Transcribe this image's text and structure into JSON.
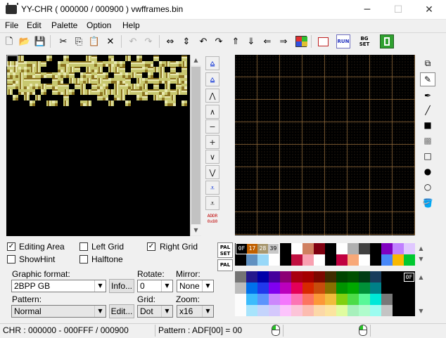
{
  "window": {
    "title": "YY-CHR ( 000000 / 000900 ) vwfframes.bin",
    "minimize_glyph": "─",
    "maximize_glyph": "☐",
    "close_glyph": "✕"
  },
  "menu": [
    "File",
    "Edit",
    "Palette",
    "Option",
    "Help"
  ],
  "toolbar_icons": [
    "new-file-icon",
    "open-folder-icon",
    "save-icon",
    "cut-icon",
    "copy-icon",
    "paste-icon",
    "delete-icon",
    "undo-icon",
    "redo-icon",
    "flip-horizontal-icon",
    "flip-vertical-icon",
    "rotate-left-icon",
    "rotate-right-icon",
    "shift-up-icon",
    "shift-down-icon",
    "shift-left-icon",
    "shift-right-icon",
    "replace-color-icon",
    "pattern-icon",
    "run-icon",
    "bg-set-icon",
    "bookmark-icon"
  ],
  "toolbar_glyphs": {
    "new": "🗋",
    "open": "📂",
    "save": "💾",
    "cut": "✂",
    "copy": "⎘",
    "paste": "📋",
    "delete": "✕",
    "undo": "↶",
    "redo": "↷",
    "flip_h": "⇔",
    "flip_v": "⇕",
    "rot_l": "↶",
    "rot_r": "↷",
    "up": "⇑",
    "down": "⇓",
    "left": "⇐",
    "right": "⇒",
    "run": "RUN",
    "bgset": "BG SET"
  },
  "nav_buttons": [
    "⩠",
    "⩠",
    "⋀",
    "∧",
    "−",
    "+",
    "∨",
    "⋁",
    "⩡",
    "⩡"
  ],
  "addr_button": {
    "line1": "ADDR",
    "line2": "0x80"
  },
  "tools_glyphs": [
    "⧉",
    "✎",
    "✒",
    "╱",
    "■",
    "▩",
    "□",
    "●",
    "○",
    "🪣"
  ],
  "checkboxes": {
    "editing_area": {
      "label": "Editing Area",
      "checked": true
    },
    "left_grid": {
      "label": "Left Grid",
      "checked": false
    },
    "right_grid": {
      "label": "Right Grid",
      "checked": true
    },
    "show_hint": {
      "label": "ShowHint",
      "checked": false
    },
    "halftone": {
      "label": "Halftone",
      "checked": false
    }
  },
  "form": {
    "graphic_format_label": "Graphic format:",
    "graphic_format": "2BPP GB",
    "info_button": "Info...",
    "rotate_label": "Rotate:",
    "rotate": "0",
    "mirror_label": "Mirror:",
    "mirror": "None",
    "pattern_label": "Pattern:",
    "pattern": "Normal",
    "edit_button": "Edit...",
    "grid_label": "Grid:",
    "grid": "Dot",
    "zoom_label": "Zoom:",
    "zoom": "x16",
    "dropdown_glyph": "▼"
  },
  "palette": {
    "pal_set_label_1": "PAL",
    "pal_set_label_2": "SET",
    "pal_label": "PAL",
    "selected_labels": [
      "0F",
      "17",
      "28",
      "39"
    ],
    "row_colors": [
      "#000000",
      "#ff7f00",
      "#d8c8a0",
      "#ffffff",
      "#000000",
      "#ffffff",
      "#d08060",
      "#800010",
      "#000000",
      "#ffffff",
      "#b0b0b0",
      "#404040",
      "#000000",
      "#8000c0",
      "#c080ff",
      "#e0c8ff",
      "#000000",
      "#6090c0",
      "#98d8f8",
      "#ffffff",
      "#000000",
      "#c01040",
      "#f8a0b0",
      "#ffffff",
      "#000000",
      "#c00040",
      "#f8a878",
      "#ffffff",
      "#000000",
      "#4888f8",
      "#f8b800",
      "#00c830"
    ],
    "master_colors": [
      "#747474",
      "#24188c",
      "#0000a8",
      "#44009c",
      "#8c0074",
      "#a80010",
      "#a40000",
      "#7c0800",
      "#402c00",
      "#004400",
      "#005000",
      "#003c14",
      "#183c5c",
      "#000000",
      "#000000",
      "#000000",
      "#bcbcbc",
      "#0070ec",
      "#2038ec",
      "#8000f0",
      "#bc00bc",
      "#e40058",
      "#d82800",
      "#c84c0c",
      "#887000",
      "#009400",
      "#00a800",
      "#009038",
      "#008088",
      "#000000",
      "#000000",
      "#000000",
      "#fcfcfc",
      "#3cbcfc",
      "#5c94fc",
      "#cc88fc",
      "#f478fc",
      "#fc74b4",
      "#fc7460",
      "#fc9838",
      "#f0bc3c",
      "#80d010",
      "#4cdc48",
      "#58f898",
      "#00e8d8",
      "#787878",
      "#000000",
      "#000000",
      "#fcfcfc",
      "#a8e4fc",
      "#c4d4fc",
      "#d4c8fc",
      "#fcc4fc",
      "#fcc4d8",
      "#fcbcb0",
      "#fcd8a8",
      "#fce4a0",
      "#e0fca0",
      "#a8f0bc",
      "#b0fccc",
      "#9cfcf0",
      "#c4c4c4",
      "#000000",
      "#000000"
    ],
    "master_selected_label": "0F"
  },
  "status": {
    "chr": "CHR : 000000 - 000FFF / 000900",
    "pattern": "Pattern : ADF[00] = 00"
  },
  "colors": {
    "tile_light": "#c8c870",
    "tile_dark": "#8c7420",
    "tile_mid": "#e8e8b0",
    "background": "#000000"
  }
}
